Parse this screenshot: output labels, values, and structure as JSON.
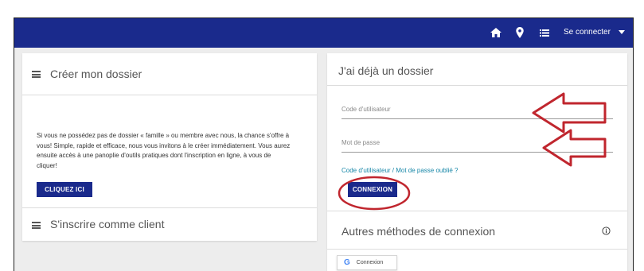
{
  "topbar": {
    "icons": [
      "home-icon",
      "location-pin-icon",
      "list-icon"
    ],
    "login_label": "Se connecter",
    "color": "#1a2a8c"
  },
  "left_card": {
    "create": {
      "title": "Créer mon dossier",
      "paragraph": "Si vous ne possédez pas de dossier « famille » ou membre avec nous, la chance s'offre à vous! Simple, rapide et efficace, nous vous invitons à le créer immédiatement. Vous aurez ensuite accès à une panoplie d'outils pratiques dont l'inscription en ligne, à vous de cliquer!",
      "button_label": "CLIQUEZ ICI"
    },
    "register": {
      "title": "S'inscrire comme client"
    }
  },
  "right_card": {
    "title": "J'ai déjà un dossier",
    "username_placeholder": "Code d'utilisateur",
    "password_placeholder": "Mot de passe",
    "forgot_link": "Code d'utilisateur / Mot de passe oublié ?",
    "connect_button": "CONNEXION",
    "other_methods_title": "Autres méthodes de connexion",
    "google_button_label": "Connexion",
    "google_letter": "G"
  },
  "annotations": {
    "color": "#c0262e"
  }
}
